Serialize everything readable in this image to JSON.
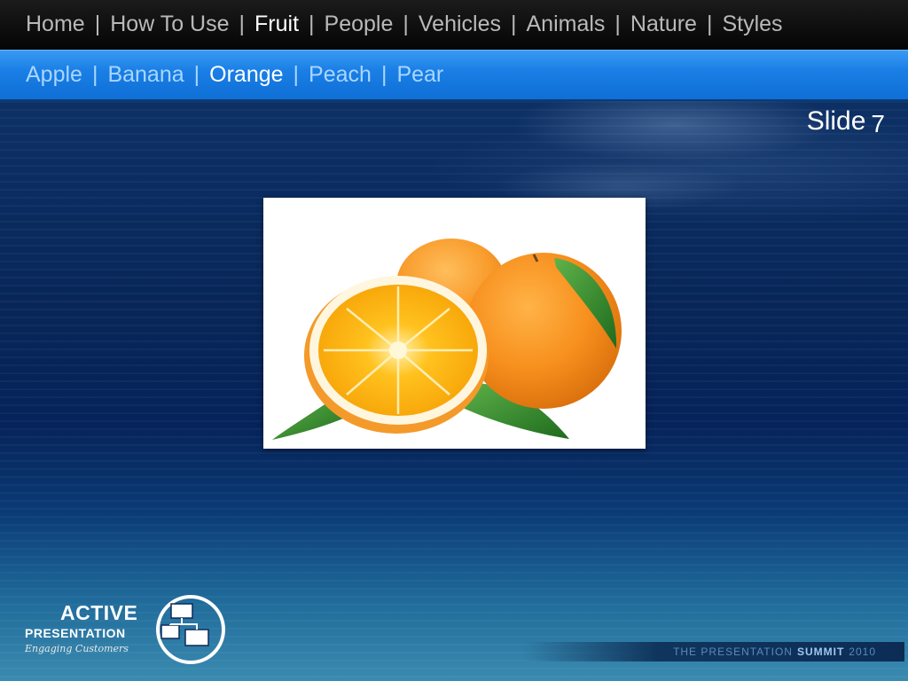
{
  "top_nav": {
    "items": [
      {
        "label": "Home",
        "active": false
      },
      {
        "label": "How To Use",
        "active": false
      },
      {
        "label": "Fruit",
        "active": true
      },
      {
        "label": "People",
        "active": false
      },
      {
        "label": "Vehicles",
        "active": false
      },
      {
        "label": "Animals",
        "active": false
      },
      {
        "label": "Nature",
        "active": false
      },
      {
        "label": "Styles",
        "active": false
      }
    ],
    "separator": "|"
  },
  "sub_nav": {
    "items": [
      {
        "label": "Apple",
        "active": false
      },
      {
        "label": "Banana",
        "active": false
      },
      {
        "label": "Orange",
        "active": true
      },
      {
        "label": "Peach",
        "active": false
      },
      {
        "label": "Pear",
        "active": false
      }
    ],
    "separator": "|"
  },
  "slide": {
    "label": "Slide",
    "number": "7"
  },
  "image": {
    "subject": "oranges",
    "icon": "orange-photo"
  },
  "logo": {
    "line1": "ACTIVE",
    "line2": "PRESENTATION",
    "line3": "Engaging Customers"
  },
  "footer": {
    "prefix": "THE PRESENTATION",
    "bold": "SUMMIT",
    "year": "2010"
  },
  "colors": {
    "top_nav_bg": "#050505",
    "sub_nav_bg": "#1a7fe6",
    "active_text": "#ffffff",
    "top_nav_text": "#b9b9b9",
    "sub_nav_text": "#a9d6ff",
    "background": "#0a2a5c"
  }
}
